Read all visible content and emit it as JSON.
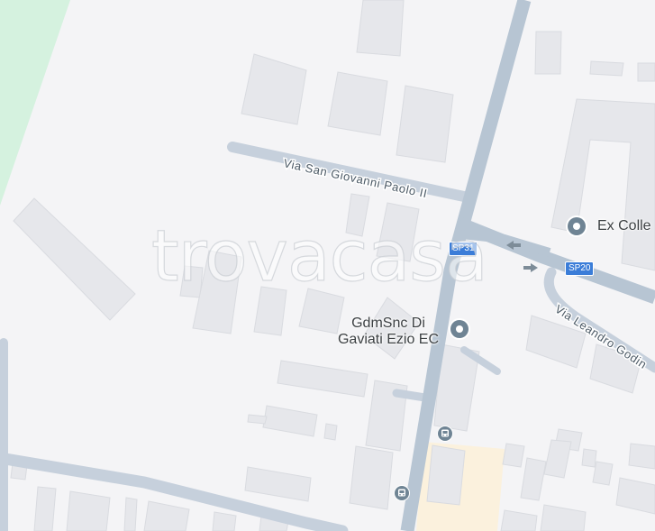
{
  "map": {
    "colors": {
      "background": "#f4f4f6",
      "park": "#d5f2df",
      "building": "#e6e7eb",
      "building_edge": "#d9dbe0",
      "road_major": "#b7c5d3",
      "road_minor": "#c6d0dc",
      "poi_pin": "#6f8494",
      "commercial": "#fbf1dd",
      "shield": "#3b7dd8"
    },
    "streets": [
      {
        "id": "via-san-giovanni",
        "name": "Via San Giovanni Paolo II"
      },
      {
        "id": "via-leandro",
        "name": "Via Leandro Godin"
      }
    ],
    "road_shields": [
      {
        "id": "sp31",
        "label": "SP31"
      },
      {
        "id": "sp20",
        "label": "SP20"
      }
    ],
    "pois": [
      {
        "id": "ex-colle",
        "name": "Ex Colle",
        "icon": "map-pin-icon"
      },
      {
        "id": "gdm",
        "name_line1": "GdmSnc Di",
        "name_line2": "Gaviati Ezio EC",
        "icon": "map-pin-icon"
      }
    ],
    "transit_icons": [
      "bus-stop-icon",
      "bus-stop-icon"
    ],
    "oneway_arrows": [
      "arrow-left-icon",
      "arrow-right-icon"
    ],
    "watermark": "trovacasa"
  }
}
